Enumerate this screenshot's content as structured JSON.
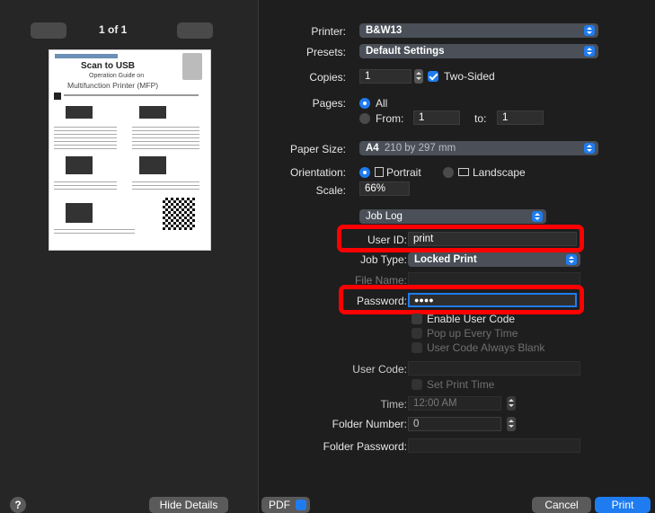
{
  "preview": {
    "page_counter": "1 of 1",
    "doc_title": "Scan to USB",
    "doc_subtitle1": "Operation Guide on",
    "doc_subtitle2": "Multifunction Printer (MFP)"
  },
  "printer": {
    "label": "Printer:",
    "value": "B&W13"
  },
  "presets": {
    "label": "Presets:",
    "value": "Default Settings"
  },
  "copies": {
    "label": "Copies:",
    "value": "1",
    "two_sided": "Two-Sided"
  },
  "pages": {
    "label": "Pages:",
    "all": "All",
    "from": "From:",
    "from_value": "1",
    "to": "to:",
    "to_value": "1"
  },
  "paper_size": {
    "label": "Paper Size:",
    "value_bold": "A4",
    "value_dim": "210 by 297 mm"
  },
  "orientation": {
    "label": "Orientation:",
    "portrait": "Portrait",
    "landscape": "Landscape"
  },
  "scale": {
    "label": "Scale:",
    "value": "66%"
  },
  "section_popup": "Job Log",
  "user_id": {
    "label": "User ID:",
    "value": "print"
  },
  "job_type": {
    "label": "Job Type:",
    "value": "Locked Print"
  },
  "file_name": {
    "label": "File Name:",
    "value": ""
  },
  "password": {
    "label": "Password:",
    "value": "●●●●"
  },
  "user_code_opts": {
    "enable": "Enable User Code",
    "popup": "Pop up Every Time",
    "blank": "User Code Always Blank"
  },
  "user_code": {
    "label": "User Code:",
    "value": ""
  },
  "set_print_time": "Set Print Time",
  "time": {
    "label": "Time:",
    "value": "12:00 AM"
  },
  "folder_number": {
    "label": "Folder Number:",
    "value": "0"
  },
  "folder_password": {
    "label": "Folder Password:",
    "value": ""
  },
  "footer": {
    "help": "?",
    "hide_details": "Hide Details",
    "pdf": "PDF",
    "cancel": "Cancel",
    "print": "Print"
  },
  "colors": {
    "accent": "#1f7cf0",
    "highlight": "#ff0000"
  }
}
